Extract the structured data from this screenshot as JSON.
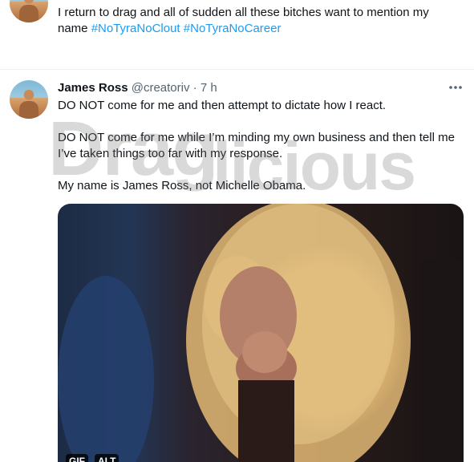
{
  "previous_tweet": {
    "text": "I return to drag and all of sudden all these bitches want to mention my name",
    "hashtags": [
      "#NoTyraNoClout",
      "#NoTyraNoCareer"
    ]
  },
  "tweet": {
    "name": "James Ross",
    "handle": "@creatoriv",
    "separator": "·",
    "time": "7 h",
    "more_icon": "more-horizontal-icon",
    "paragraphs": [
      "DO NOT come for me and then attempt to dictate how I react.",
      "DO NOT come for me while I’m minding my own business and then tell me I’ve taken things too far with my response.",
      "My name is James Ross, not Michelle Obama."
    ],
    "media": {
      "gif_label": "GIF",
      "alt_label": "ALT"
    }
  },
  "watermark": {
    "text": "DragAlicious"
  },
  "colors": {
    "link": "#1d9bf0",
    "secondary_text": "#536471",
    "primary_text": "#0f1419"
  }
}
